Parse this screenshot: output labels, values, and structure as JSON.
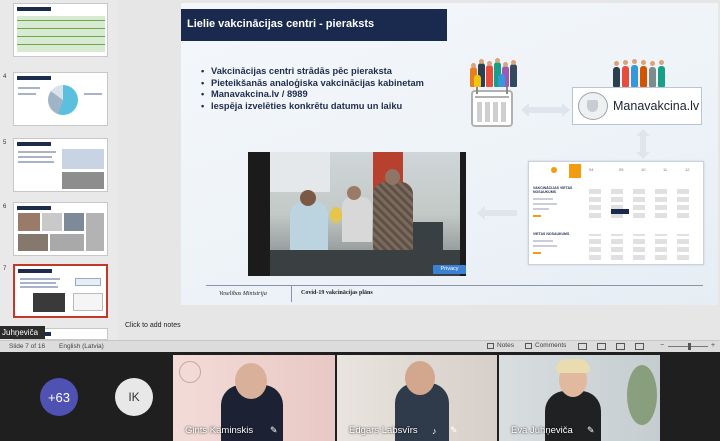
{
  "slide": {
    "title": "Lielie vakcinācijas centri - pieraksts",
    "bullets": [
      "Vakcinācijas centri strādās pēc pieraksta",
      "Pieteikšanās analoģiska vakcinācijas kabinetam",
      "Manavakcina.lv / 8989",
      "Iespēja izvelēties konkrētu datumu un laiku"
    ],
    "logo_text": "Manavakcina.lv",
    "privacy_label": "Privacy",
    "footer_left": "Veselības Ministrija",
    "footer_right": "Covid-19 vakcinācijas plāns"
  },
  "thumbnails": [
    {
      "number": "4",
      "active": false
    },
    {
      "number": "5",
      "active": false
    },
    {
      "number": "6",
      "active": false
    },
    {
      "number": "7",
      "active": true
    }
  ],
  "notes": {
    "placeholder": "Click to add notes"
  },
  "statusbar": {
    "slide_counter": "Slide 7 of 16",
    "language": "English (Latvia)",
    "notes_label": "Notes",
    "comments_label": "Comments"
  },
  "presenter_tag": "Juhņeviča",
  "gallery": {
    "more_count": "+63",
    "initials": "IK",
    "participants": [
      {
        "name": "Gints Kaminskis"
      },
      {
        "name": "Edgars Labsvīrs"
      },
      {
        "name": "Eva Juhņeviča"
      }
    ],
    "booking_times": [
      "10",
      "11",
      "12"
    ],
    "booking_header": "VAKCINĀCIJAS VIETAS NOSAUKUMS",
    "booking_header2": "VIETAS NOSAUKUMS"
  },
  "colors": {
    "slide_title_bg": "#1a2a4f",
    "accent_orange": "#f39c12",
    "teams_purple": "#4f52b2",
    "active_thumb_border": "#c0392b"
  }
}
